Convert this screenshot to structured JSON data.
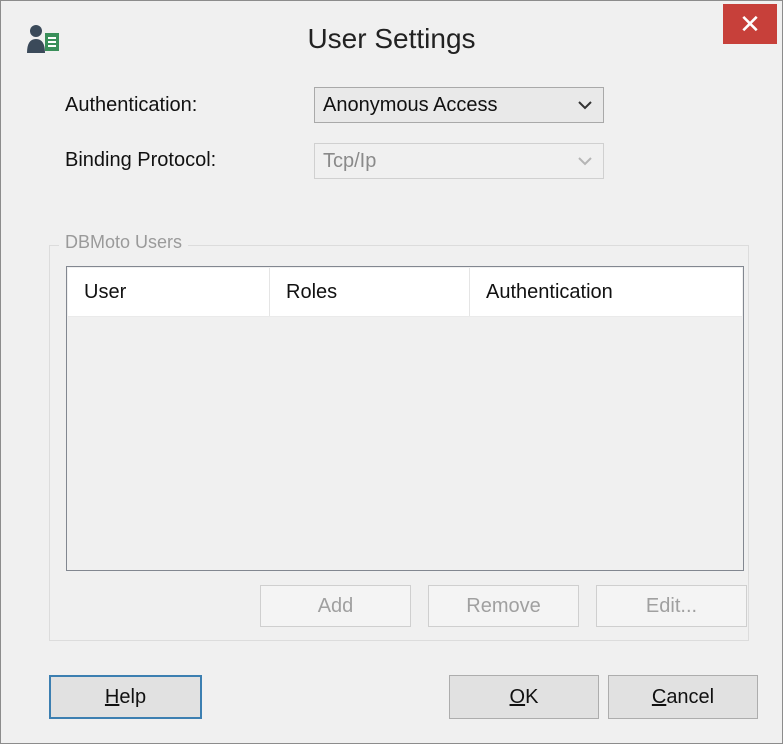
{
  "window": {
    "title": "User Settings",
    "close_glyph": "✕",
    "app_icon": "user-settings-icon"
  },
  "form": {
    "authentication_label": "Authentication:",
    "authentication_value": "Anonymous Access",
    "binding_label": "Binding Protocol:",
    "binding_value": "Tcp/Ip"
  },
  "users_group": {
    "title": "DBMoto Users",
    "columns": [
      "User",
      "Roles",
      "Authentication"
    ],
    "rows": []
  },
  "group_buttons": {
    "add": "Add",
    "remove": "Remove",
    "edit": "Edit..."
  },
  "footer": {
    "help_mnemonic": "H",
    "help_rest": "elp",
    "ok_mnemonic": "O",
    "ok_rest": "K",
    "cancel_mnemonic": "C",
    "cancel_rest": "ancel"
  },
  "colors": {
    "close_button": "#c7403a",
    "default_button_border": "#3c7fb1"
  }
}
